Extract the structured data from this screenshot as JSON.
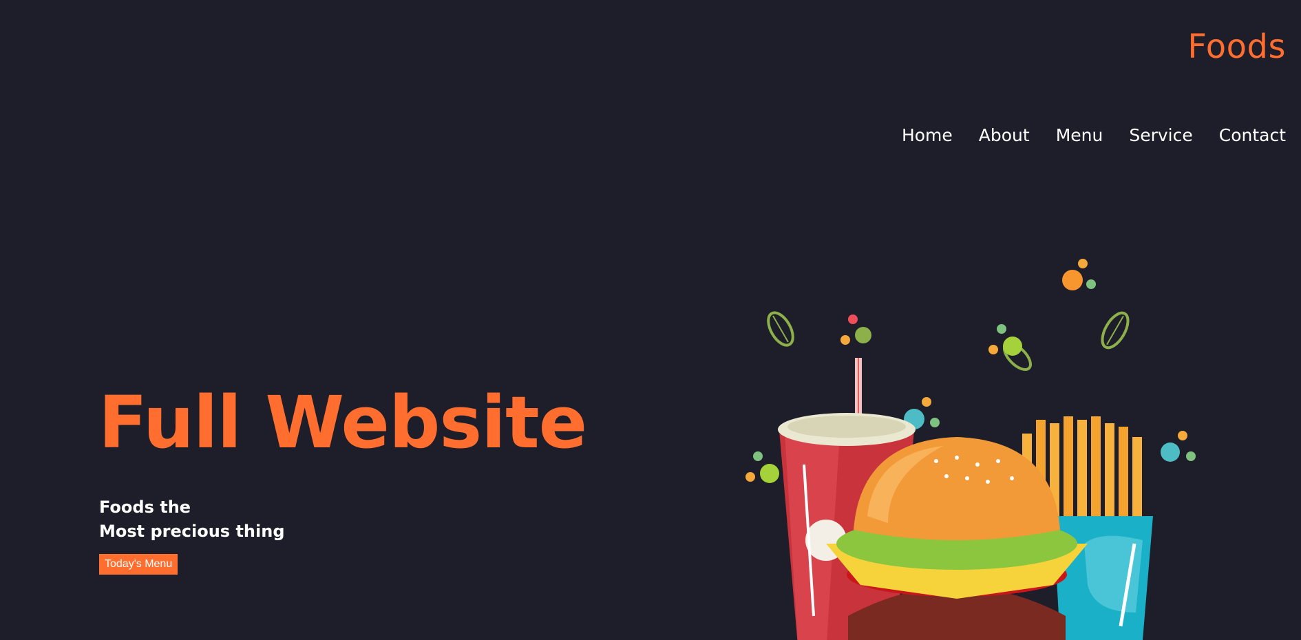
{
  "header": {
    "logo": "Foods",
    "nav": [
      "Home",
      "About",
      "Menu",
      "Service",
      "Contact"
    ]
  },
  "hero": {
    "title": "Full Website",
    "tagline_line1": "Foods the",
    "tagline_line2": "Most precious thing",
    "button_label": "Today's Menu"
  },
  "illustration": {
    "icons": [
      "soda-cup-icon",
      "burger-icon",
      "fries-icon",
      "leaf-icon"
    ]
  },
  "colors": {
    "background": "#1e1d2a",
    "accent": "#ff6e2e",
    "text": "#ffffff"
  }
}
